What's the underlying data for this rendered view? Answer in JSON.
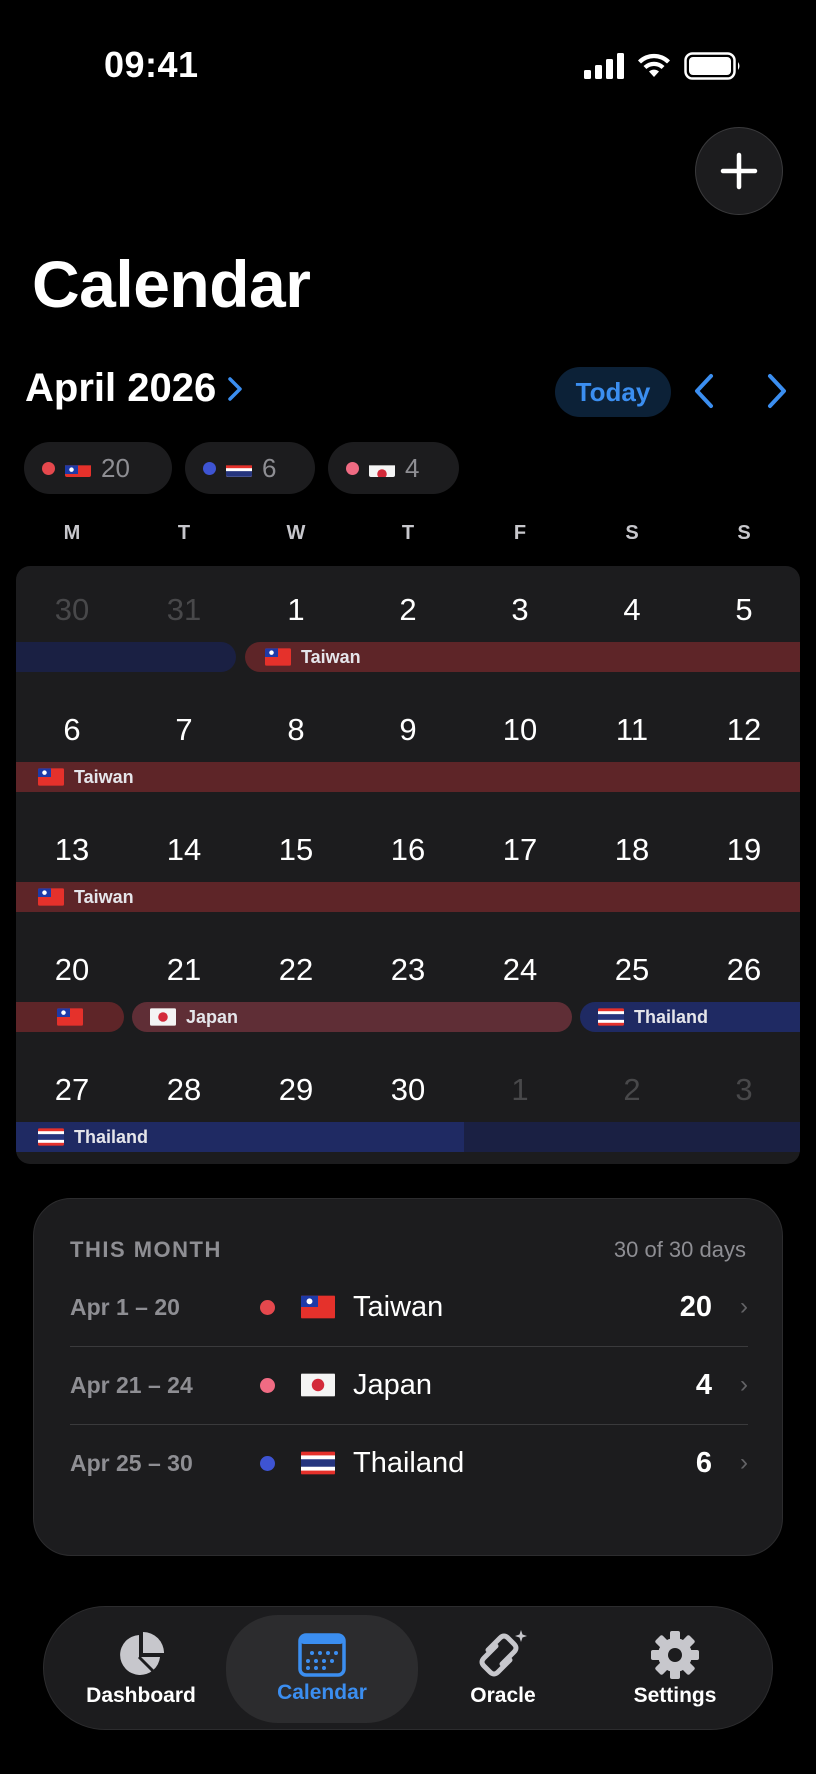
{
  "status": {
    "time": "09:41"
  },
  "header": {
    "title": "Calendar"
  },
  "month": {
    "label": "April 2026",
    "today_label": "Today"
  },
  "chips": [
    {
      "country": "Taiwan",
      "count": "20",
      "dot_color": "#e5484d"
    },
    {
      "country": "Thailand",
      "count": "6",
      "dot_color": "#3e54d3"
    },
    {
      "country": "Japan",
      "count": "4",
      "dot_color": "#f06b83"
    }
  ],
  "weekdays": [
    "M",
    "T",
    "W",
    "T",
    "F",
    "S",
    "S"
  ],
  "calendar": {
    "weeks": [
      [
        "30",
        "31",
        "1",
        "2",
        "3",
        "4",
        "5"
      ],
      [
        "6",
        "7",
        "8",
        "9",
        "10",
        "11",
        "12"
      ],
      [
        "13",
        "14",
        "15",
        "16",
        "17",
        "18",
        "19"
      ],
      [
        "20",
        "21",
        "22",
        "23",
        "24",
        "25",
        "26"
      ],
      [
        "27",
        "28",
        "29",
        "30",
        "1",
        "2",
        "3"
      ]
    ],
    "bars": {
      "w1_taiwan": "Taiwan",
      "w2_taiwan": "Taiwan",
      "w3_taiwan": "Taiwan",
      "w4_japan": "Japan",
      "w4_thailand": "Thailand",
      "w5_thailand": "Thailand"
    }
  },
  "summary": {
    "heading": "THIS MONTH",
    "count": "30 of 30 days",
    "rows": [
      {
        "range": "Apr 1 – 20",
        "country": "Taiwan",
        "days": "20",
        "dot_color": "#e5484d"
      },
      {
        "range": "Apr 21 – 24",
        "country": "Japan",
        "days": "4",
        "dot_color": "#f06b83"
      },
      {
        "range": "Apr 25 – 30",
        "country": "Thailand",
        "days": "6",
        "dot_color": "#3e54d3"
      }
    ]
  },
  "tabs": [
    {
      "label": "Dashboard",
      "icon": "pie-chart-icon"
    },
    {
      "label": "Calendar",
      "icon": "calendar-icon"
    },
    {
      "label": "Oracle",
      "icon": "oracle-icon"
    },
    {
      "label": "Settings",
      "icon": "gear-icon"
    }
  ],
  "colors": {
    "accent": "#3b8ef0",
    "taiwan_bar": "#5e2528",
    "japan_bar": "#5f2e36",
    "thailand_bar": "#1f2a63"
  }
}
